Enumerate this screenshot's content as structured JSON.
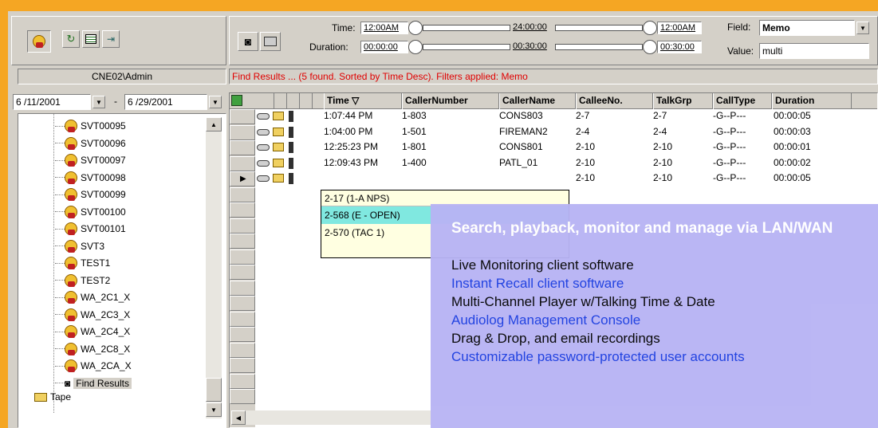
{
  "toolbar": {
    "time_label": "Time:",
    "time_start": "12:00AM",
    "time_mid": "24:00:00",
    "time_end": "12:00AM",
    "duration_label": "Duration:",
    "duration_start": "00:00:00",
    "duration_mid": "00:30:00",
    "duration_end": "00:30:00",
    "field_label": "Field:",
    "field_value": "Memo",
    "value_label": "Value:",
    "value_value": "multi"
  },
  "user_label": "CNE02\\Admin",
  "status_message": "Find Results ... (5 found. Sorted by Time Desc). Filters applied: Memo",
  "date_range": {
    "from": "6 /11/2001",
    "separator": "-",
    "to": "6 /29/2001"
  },
  "tree": {
    "items": [
      "SVT00095",
      "SVT00096",
      "SVT00097",
      "SVT00098",
      "SVT00099",
      "SVT00100",
      "SVT00101",
      "SVT3",
      "TEST1",
      "TEST2",
      "WA_2C1_X",
      "WA_2C3_X",
      "WA_2C4_X",
      "WA_2C8_X",
      "WA_2CA_X"
    ],
    "find_results": "Find Results",
    "tape": "Tape"
  },
  "grid": {
    "columns": [
      "Time ▽",
      "CallerNumber",
      "CallerName",
      "CalleeNo.",
      "TalkGrp",
      "CallType",
      "Duration"
    ],
    "rows": [
      {
        "time": "1:07:44 PM",
        "caller_number": "1-803",
        "caller_name": "CONS803",
        "callee": "2-7",
        "talkgrp": "2-7",
        "calltype": "-G--P---",
        "duration": "00:00:05"
      },
      {
        "time": "1:04:00 PM",
        "caller_number": "1-501",
        "caller_name": "FIREMAN2",
        "callee": "2-4",
        "talkgrp": "2-4",
        "calltype": "-G--P---",
        "duration": "00:00:03"
      },
      {
        "time": "12:25:23 PM",
        "caller_number": "1-801",
        "caller_name": "CONS801",
        "callee": "2-10",
        "talkgrp": "2-10",
        "calltype": "-G--P---",
        "duration": "00:00:01"
      },
      {
        "time": "12:09:43 PM",
        "caller_number": "1-400",
        "caller_name": "PATL_01",
        "callee": "2-10",
        "talkgrp": "2-10",
        "calltype": "-G--P---",
        "duration": "00:00:02"
      },
      {
        "time": "",
        "caller_number": "",
        "caller_name": "",
        "callee": "2-10",
        "talkgrp": "2-10",
        "calltype": "-G--P---",
        "duration": "00:00:05"
      }
    ]
  },
  "dropdown": {
    "items": [
      "2-17 (1-A NPS)",
      "2-568 (E - OPEN)",
      "2-570 (TAC 1)"
    ]
  },
  "promo": {
    "heading": "Search, playback, monitor and manage via LAN/WAN",
    "lines": [
      {
        "text": "Live Monitoring client software",
        "color": "#000000"
      },
      {
        "text": "Instant Recall client software",
        "color": "#1a3ce0"
      },
      {
        "text": "Multi-Channel Player w/Talking Time & Date",
        "color": "#000000"
      },
      {
        "text": "Audiolog Management Console",
        "color": "#1a3ce0"
      },
      {
        "text": "Drag & Drop, and email recordings",
        "color": "#000000"
      },
      {
        "text": "Customizable password-protected user accounts",
        "color": "#1a3ce0"
      }
    ]
  },
  "colors": {
    "orange_frame": "#f5a623",
    "status_red": "#e00000",
    "promo_bg": "#b8b4f4",
    "highlight_cyan": "#80e8e0",
    "tooltip_bg": "#ffffe1"
  }
}
